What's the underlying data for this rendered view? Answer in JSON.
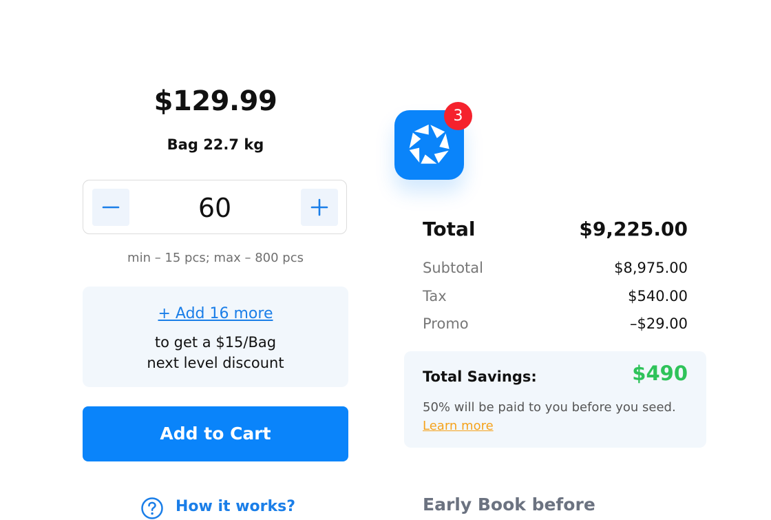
{
  "product": {
    "price": "$129.99",
    "unit": "Bag 22.7 kg"
  },
  "quantity": {
    "value": "60",
    "minus_icon": "minus-icon",
    "plus_icon": "plus-icon",
    "limits": "min –  15 pcs;  max – 800 pcs"
  },
  "promo": {
    "link": "+ Add 16 more",
    "line1": "to get a $15/Bag",
    "line2": "next level discount"
  },
  "cart": {
    "button": "Add to Cart"
  },
  "help": {
    "icon": "question-circle-icon",
    "label": "How it works?"
  },
  "app_icon": {
    "icon": "aperture-logo-icon",
    "badge_count": "3"
  },
  "summary": {
    "total_label": "Total",
    "total_value": "$9,225.00",
    "subtotal_label": "Subtotal",
    "subtotal_value": "$8,975.00",
    "tax_label": "Tax",
    "tax_value": "$540.00",
    "promo_label": "Promo",
    "promo_value": "–$29.00"
  },
  "savings": {
    "label": "Total Savings:",
    "value": "$490",
    "note": "50% will be paid to you before you seed.",
    "learn_more": "Learn more"
  },
  "early_book": {
    "title": "Early Book before"
  },
  "colors": {
    "accent": "#0a84fa",
    "link": "#1a7ee8",
    "savings": "#2fc35a",
    "badge": "#f5222d",
    "learn_more": "#f5a21b",
    "panel": "#f2f7fc"
  }
}
